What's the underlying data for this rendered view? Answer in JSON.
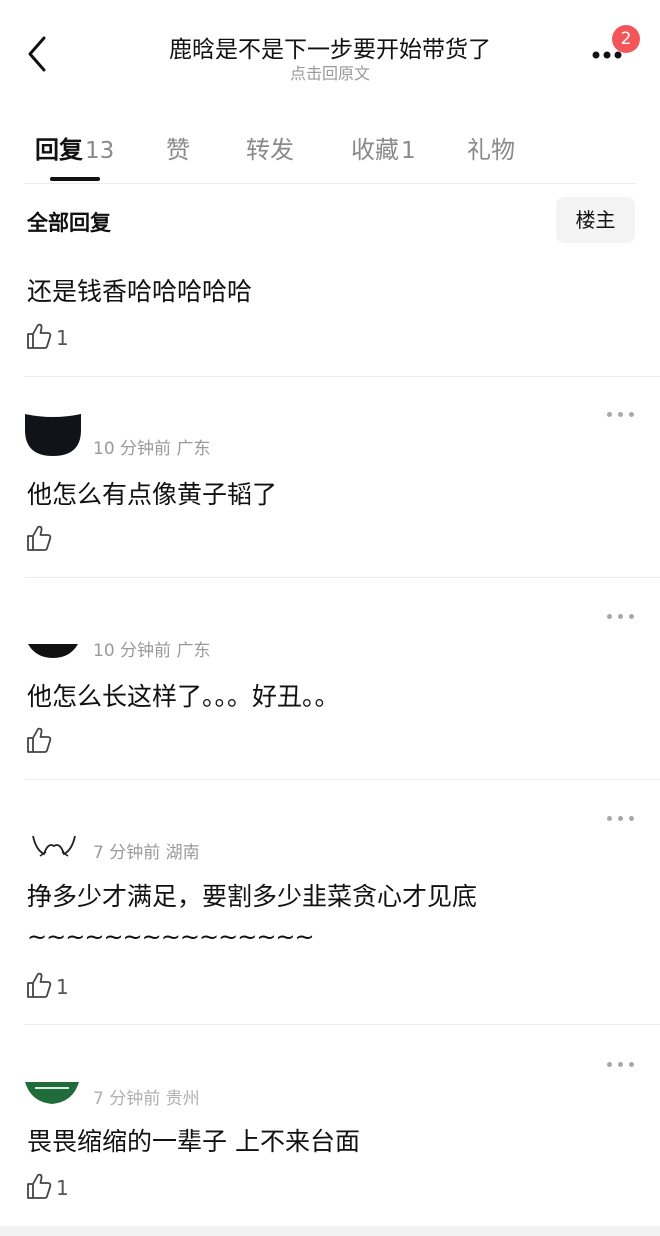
{
  "header": {
    "title": "鹿晗是不是下一步要开始带货了",
    "subtitle": "点击回原文",
    "badge_count": "2"
  },
  "tabs": [
    {
      "label": "回复",
      "count": "13"
    },
    {
      "label": "赞",
      "count": ""
    },
    {
      "label": "转发",
      "count": ""
    },
    {
      "label": "收藏",
      "count": "1"
    },
    {
      "label": "礼物",
      "count": ""
    }
  ],
  "section": {
    "label": "全部回复",
    "owner_button": "楼主"
  },
  "comments": [
    {
      "text": "还是钱香哈哈哈哈哈",
      "likes": "1"
    },
    {
      "meta": "10 分钟前  广东",
      "text": "他怎么有点像黄子韬了",
      "likes": ""
    },
    {
      "meta": "10 分钟前  广东",
      "text": "他怎么长这样了。。。好丑。。",
      "likes": ""
    },
    {
      "meta": "7 分钟前  湖南",
      "text": "挣多少才满足，要割多少韭菜贪心才见底",
      "text2": "~~~~~~~~~~~~~~~",
      "likes": "1"
    },
    {
      "meta": "7 分钟前  贵州",
      "text": "畏畏缩缩的一辈子 上不来台面",
      "likes": "1"
    }
  ],
  "colors": {
    "badge": "#f2555a",
    "muted": "#9a9a9a",
    "text": "#111111"
  }
}
